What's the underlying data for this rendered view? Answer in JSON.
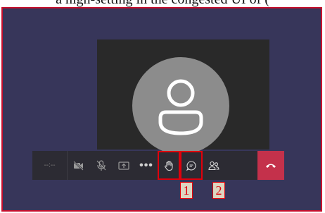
{
  "caption": {
    "text": "a high-setting in the congested UI of ("
  },
  "call": {
    "timer": "--:--",
    "annotations": [
      "1",
      "2"
    ]
  },
  "toolbar": {
    "buttons": [
      {
        "icon": "camera-off-icon"
      },
      {
        "icon": "mic-off-icon"
      },
      {
        "icon": "share-screen-icon"
      },
      {
        "icon": "more-actions-icon",
        "label": "•••"
      },
      {
        "icon": "raise-hand-icon"
      },
      {
        "icon": "chat-icon"
      },
      {
        "icon": "participants-icon"
      },
      {
        "icon": "hang-up-icon"
      }
    ]
  },
  "colors": {
    "background": "#37365a",
    "stage": "#292929",
    "avatar": "#8c8c8c",
    "toolbar": "#2c2b33",
    "hangup": "#c4314b",
    "highlight": "#e0000c"
  }
}
